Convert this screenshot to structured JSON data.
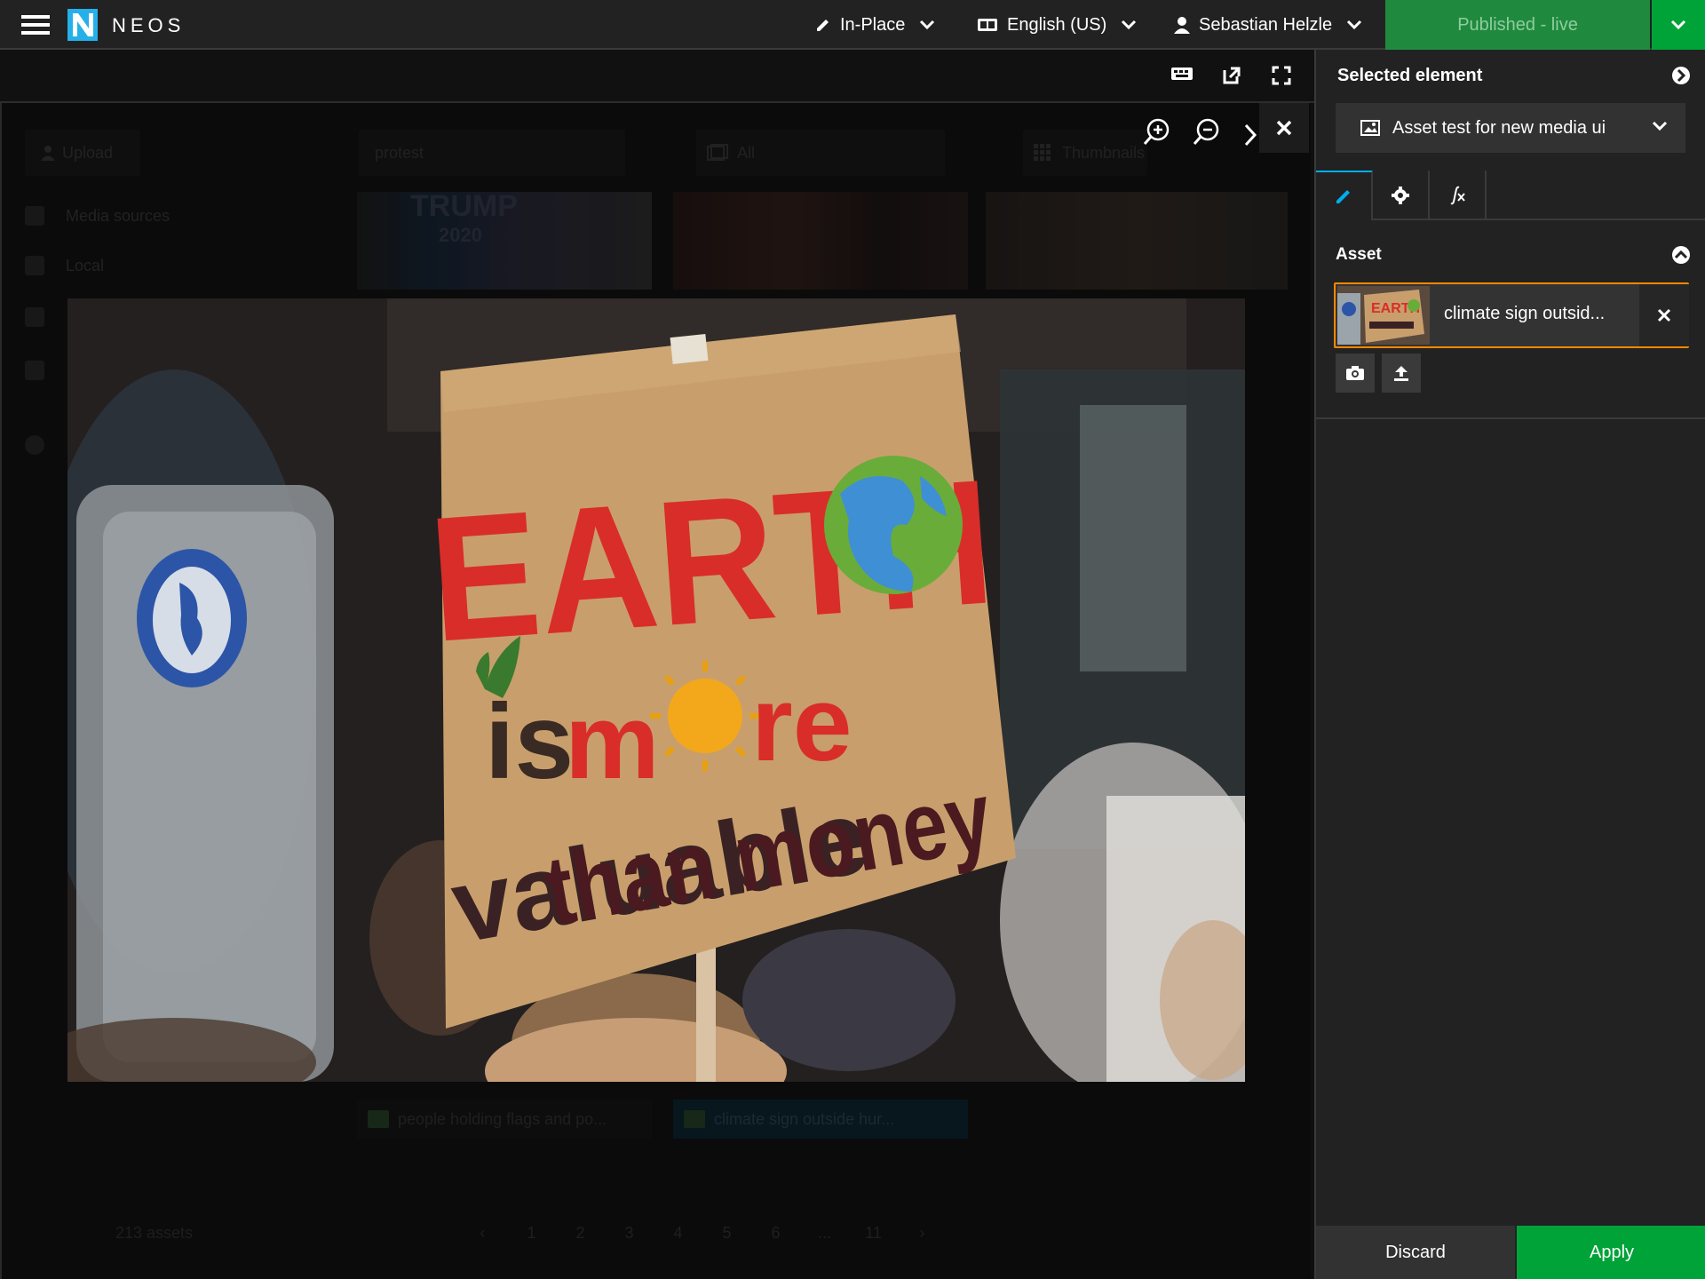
{
  "topbar": {
    "brand": "NEOS",
    "edit_mode": "In-Place",
    "language": "English (US)",
    "user": "Sebastian Helzle",
    "publish_label": "Published - live"
  },
  "inspector": {
    "title": "Selected element",
    "node_type": "Asset test for new media ui",
    "group_label": "Asset",
    "asset_name": "climate sign outsid...",
    "discard_label": "Discard",
    "apply_label": "Apply"
  },
  "media": {
    "upload_label": "Upload",
    "search_value": "protest",
    "filter_value": "All",
    "view_value": "Thumbnails",
    "sources_label": "Media sources",
    "local_label": "Local",
    "thumb_text": "TRUMP",
    "thumb_year": "2020",
    "captions": [
      "people holding flags and po...",
      "climate sign outside hur..."
    ],
    "asset_count": "213 assets",
    "pages": [
      "‹",
      "1",
      "2",
      "3",
      "4",
      "5",
      "6",
      "...",
      "11",
      "›"
    ]
  },
  "sign": {
    "line1": "EARTH",
    "line2a": "is m",
    "line2b": "re",
    "line3": "valuable",
    "line3b": "than money"
  },
  "colors": {
    "accent_green": "#00a338",
    "publish_green": "#1f8a3e",
    "focus_orange": "#ff8700",
    "tab_active_blue": "#00adee"
  }
}
